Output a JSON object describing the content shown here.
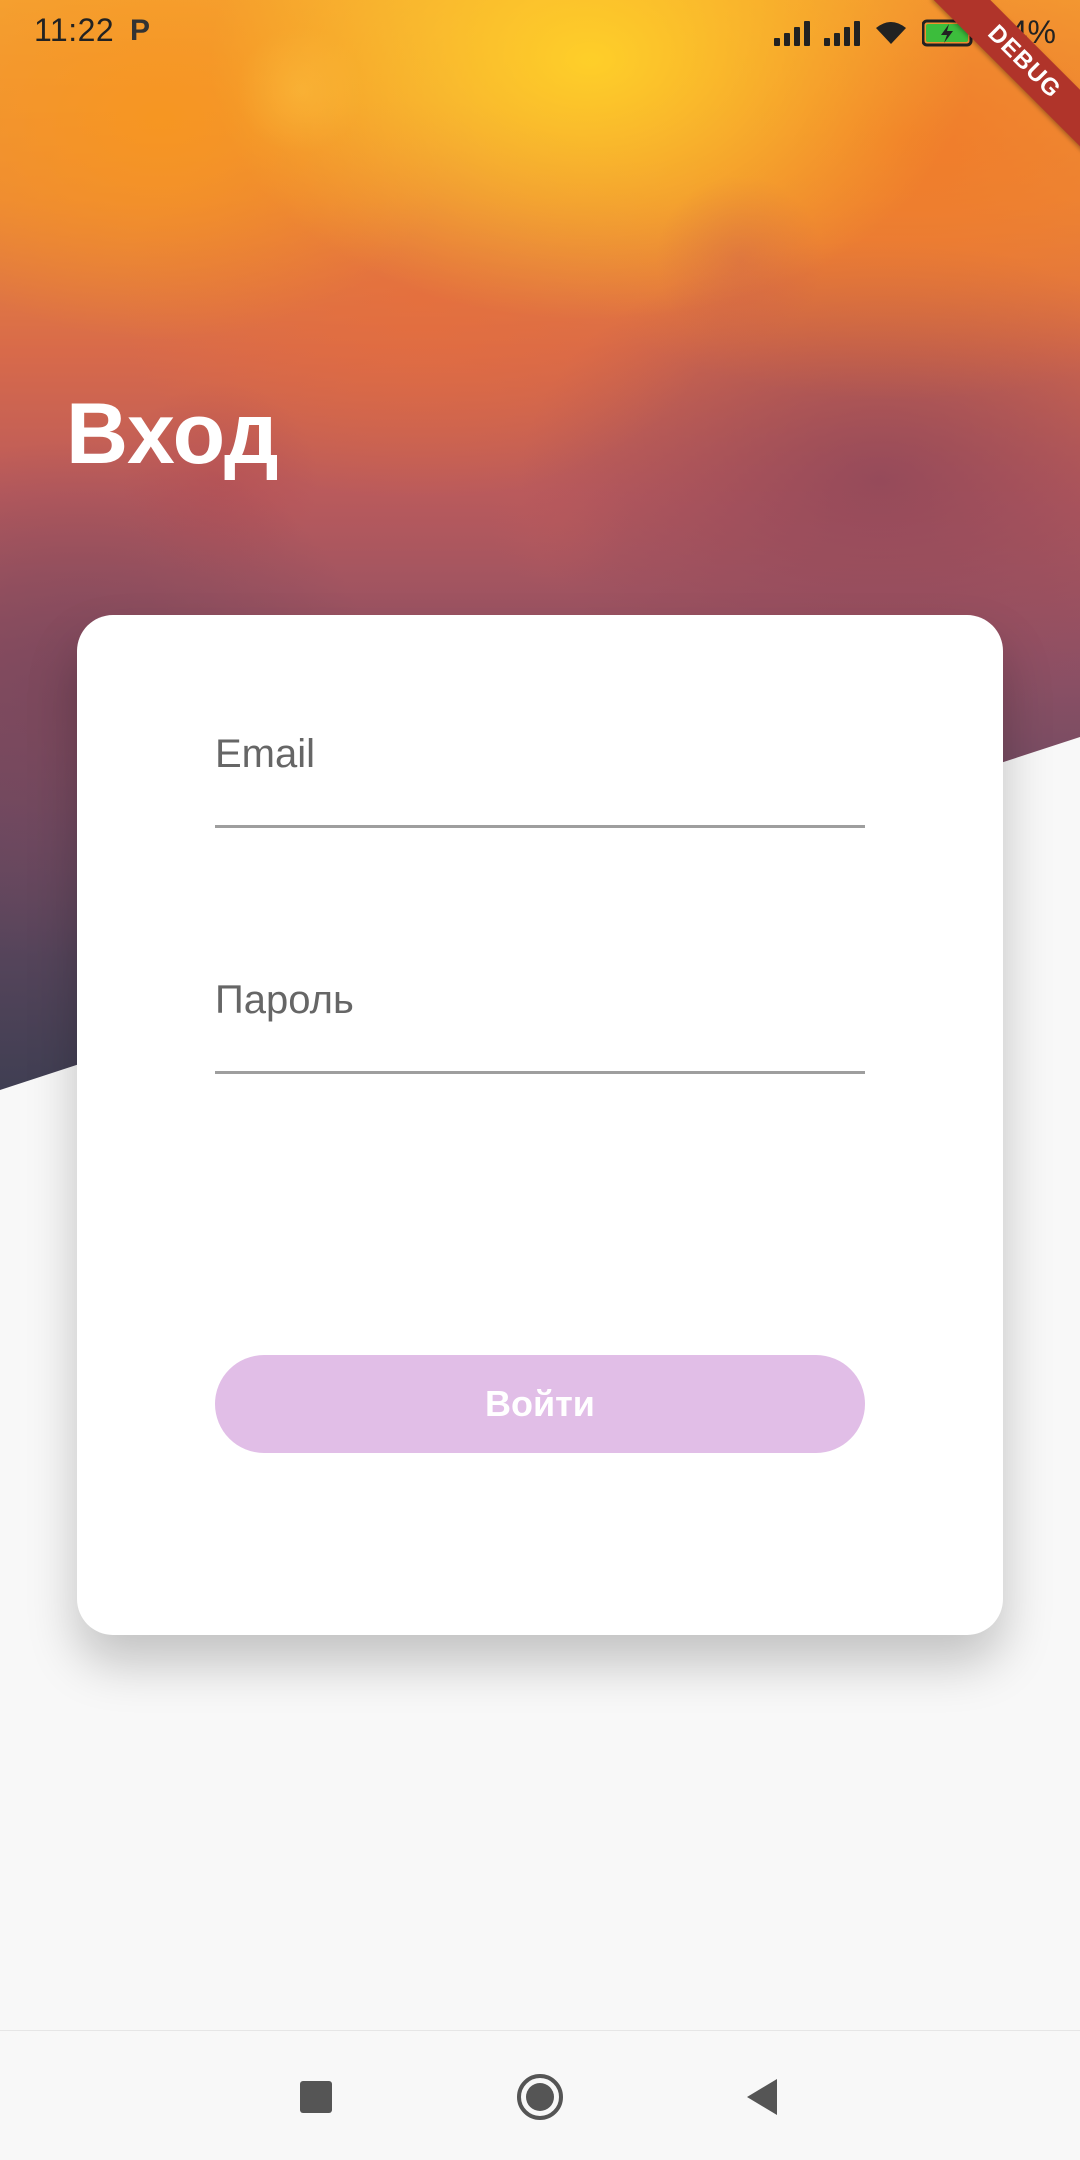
{
  "status_bar": {
    "time": "11:22",
    "app_icon_glyph": "P",
    "battery_percent": "94%",
    "icons": [
      "signal-icon",
      "signal-icon",
      "wifi-icon",
      "battery-charging-icon"
    ]
  },
  "debug_banner": {
    "label": "DEBUG",
    "color": "#b0342a"
  },
  "header": {
    "title": "Вход"
  },
  "form": {
    "email": {
      "label": "Email",
      "value": ""
    },
    "password": {
      "label": "Пароль",
      "value": ""
    },
    "submit_label": "Войти",
    "submit_color": "#e1bee7"
  },
  "nav_bar": {
    "items": [
      "recents-icon",
      "home-icon",
      "back-icon"
    ]
  }
}
